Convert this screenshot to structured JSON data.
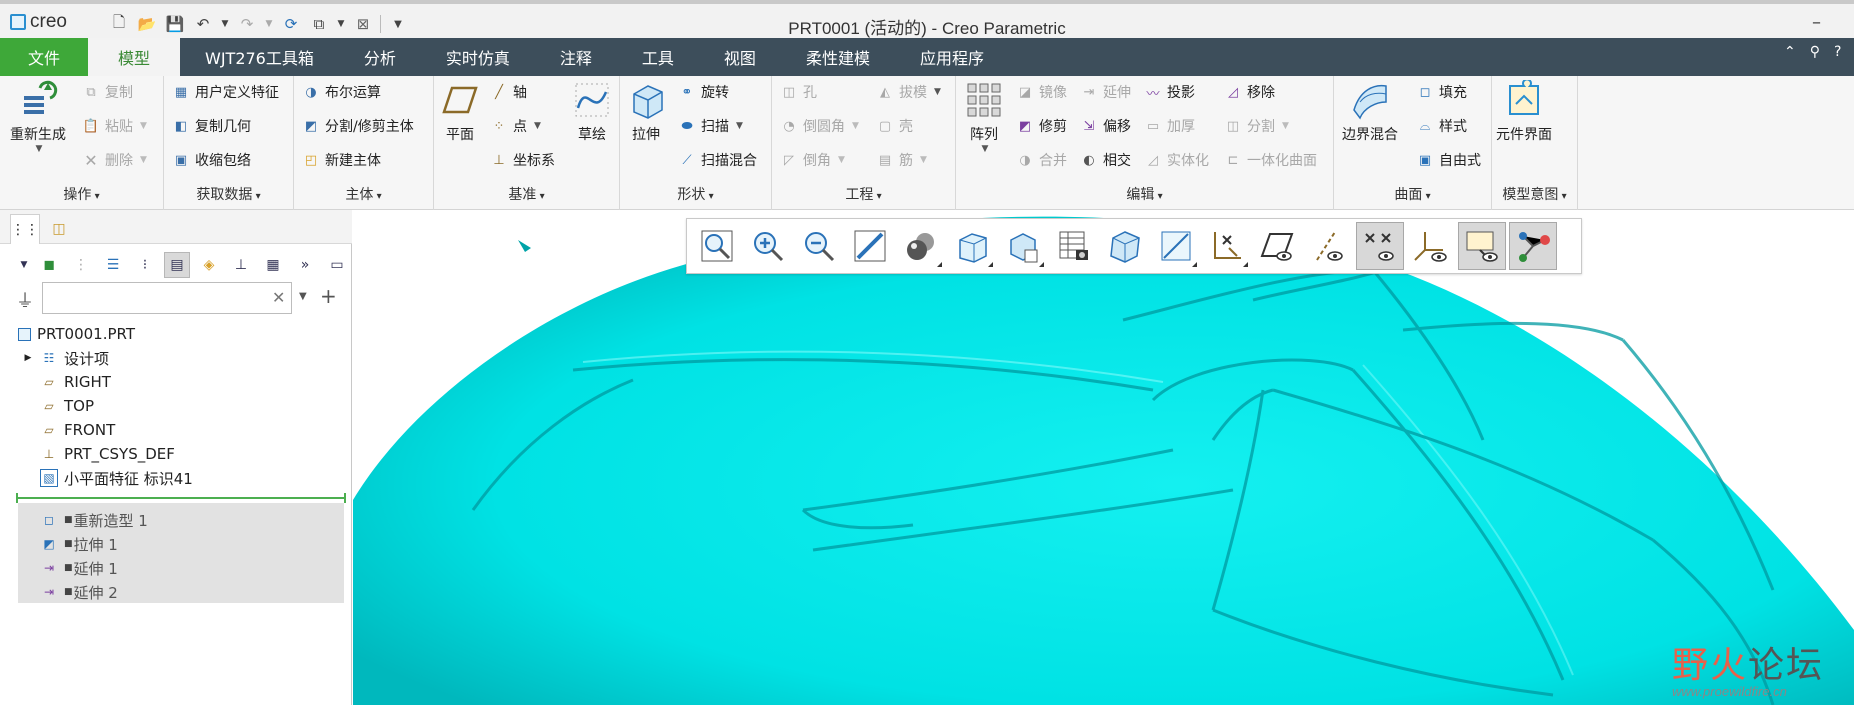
{
  "app": {
    "logo_text": "creo",
    "window_title": "PRT0001 (活动的) - Creo Parametric",
    "window_min": "–"
  },
  "quick_access": {
    "icons": [
      "new-file-icon",
      "open-file-icon",
      "save-icon",
      "undo-icon",
      "redo-icon",
      "regenerate-icon",
      "window-icon",
      "close-window-icon",
      "customize-icon"
    ]
  },
  "tabs": [
    {
      "label": "文件",
      "state": "file"
    },
    {
      "label": "模型",
      "state": "active"
    },
    {
      "label": "WJT276工具箱"
    },
    {
      "label": "分析"
    },
    {
      "label": "实时仿真"
    },
    {
      "label": "注释"
    },
    {
      "label": "工具"
    },
    {
      "label": "视图"
    },
    {
      "label": "柔性建模"
    },
    {
      "label": "应用程序"
    }
  ],
  "ribbon": {
    "operations": {
      "label": "操作",
      "regen": "重新生成",
      "copy": "复制",
      "paste": "粘贴",
      "delete": "删除"
    },
    "get_data": {
      "label": "获取数据",
      "udf": "用户定义特征",
      "copy_geom": "复制几何",
      "shrinkwrap": "收缩包络"
    },
    "body": {
      "label": "主体",
      "boolean": "布尔运算",
      "split_trim": "分割/修剪主体",
      "new_body": "新建主体"
    },
    "datum": {
      "label": "基准",
      "plane": "平面",
      "axis": "轴",
      "point": "点",
      "csys": "坐标系",
      "sketch": "草绘"
    },
    "shapes": {
      "label": "形状",
      "extrude": "拉伸",
      "revolve": "旋转",
      "sweep": "扫描",
      "swept_blend": "扫描混合"
    },
    "engineering": {
      "label": "工程",
      "hole": "孔",
      "round": "倒圆角",
      "chamfer": "倒角",
      "draft": "拔模",
      "shell": "壳",
      "rib": "筋"
    },
    "editing": {
      "label": "编辑",
      "pattern": "阵列",
      "mirror": "镜像",
      "trim": "修剪",
      "merge": "合并",
      "extend": "延伸",
      "offset": "偏移",
      "intersect": "相交",
      "project": "投影",
      "thicken": "加厚",
      "solidify": "实体化",
      "remove": "移除",
      "split": "分割",
      "unify": "一体化曲面"
    },
    "surfaces": {
      "label": "曲面",
      "boundary_blend": "边界混合",
      "fill": "填充",
      "style": "样式",
      "freestyle": "自由式"
    },
    "model_intent": {
      "label": "模型意图",
      "component_interface": "元件界面"
    }
  },
  "model_tree": {
    "search_placeholder": "",
    "root": "PRT0001.PRT",
    "items": [
      {
        "label": "设计项",
        "icon": "design-items-icon"
      },
      {
        "label": "RIGHT",
        "icon": "datum-plane-icon"
      },
      {
        "label": "TOP",
        "icon": "datum-plane-icon"
      },
      {
        "label": "FRONT",
        "icon": "datum-plane-icon"
      },
      {
        "label": "PRT_CSYS_DEF",
        "icon": "csys-icon"
      },
      {
        "label": "小平面特征 标识41",
        "icon": "facet-feature-icon"
      }
    ],
    "suppressed": [
      {
        "label": "重新造型 1",
        "icon": "restyle-icon"
      },
      {
        "label": "拉伸 1",
        "icon": "extrude-icon"
      },
      {
        "label": "延伸 1",
        "icon": "extend-icon"
      },
      {
        "label": "延伸 2",
        "icon": "extend-icon"
      }
    ]
  },
  "view_toolbar": {
    "buttons": [
      {
        "name": "refit-icon"
      },
      {
        "name": "zoom-in-icon"
      },
      {
        "name": "zoom-out-icon"
      },
      {
        "name": "repaint-icon"
      },
      {
        "name": "display-style-icon",
        "dropdown": true
      },
      {
        "name": "saved-orientations-icon",
        "dropdown": true
      },
      {
        "name": "view-manager-icon",
        "dropdown": true
      },
      {
        "name": "perspective-view-icon"
      },
      {
        "name": "section-view-icon"
      },
      {
        "name": "annotation-display-icon",
        "dropdown": true
      },
      {
        "name": "datum-display-filters-icon",
        "dropdown": true
      },
      {
        "name": "plane-display-icon"
      },
      {
        "name": "axis-display-icon"
      },
      {
        "name": "point-display-icon",
        "active": true
      },
      {
        "name": "csys-display-icon"
      },
      {
        "name": "spin-center-icon",
        "active": true
      },
      {
        "name": "pick-tree-icon",
        "active": true
      }
    ]
  },
  "watermark": {
    "text_a": "野火",
    "text_b": "论坛",
    "url": "www.proewildfire.cn"
  },
  "colors": {
    "model": "#00e6e6",
    "tabbar": "#3d4e5b",
    "file_tab": "#3ea839",
    "accent_green": "#4caf50"
  }
}
